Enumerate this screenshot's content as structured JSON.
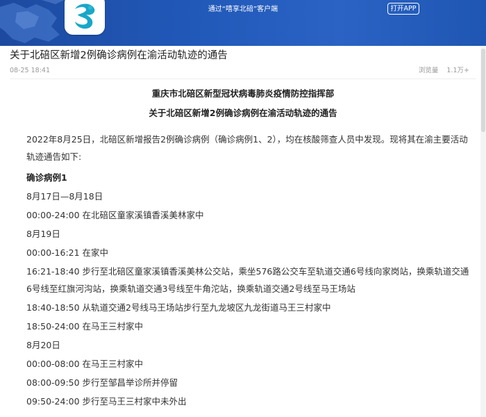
{
  "header": {
    "promo_text": "通过“嘻享北碚”客户端",
    "open_app_label": "打开APP",
    "logo_icon": "beibei-app-logo-icon",
    "brand_color": "#2159b9"
  },
  "article": {
    "title": "关于北碚区新增2例确诊病例在渝活动轨迹的通告",
    "time": "08-25 18:41",
    "views_label": "浏览量",
    "views_count": "1.1万+",
    "doc_heading_1": "重庆市北碚区新型冠状病毒肺炎疫情防控指挥部",
    "doc_heading_2": "关于北碚区新增2例确诊病例在渝活动轨迹的通告",
    "intro": "2022年8月25日，北碚区新增报告2例确诊病例（确诊病例1、2），均在核酸筛查人员中发现。现将其在渝主要活动轨迹通告如下:",
    "case1_label": "确诊病例1",
    "lines": [
      "8月17日—8月18日",
      "00:00-24:00 在北碚区童家溪镇香溪美林家中",
      "8月19日",
      "00:00-16:21 在家中",
      "16:21-18:40 步行至北碚区童家溪镇香溪美林公交站，乘坐576路公交车至轨道交通6号线向家岗站，换乘轨道交通6号线至红旗河沟站，换乘轨道交通3号线至牛角沱站，换乘轨道交通2号线至马王场站",
      "18:40-18:50 从轨道交通2号线马王场站步行至九龙坡区九龙街道马王三村家中",
      "18:50-24:00 在马王三村家中",
      "8月20日",
      "00:00-08:00 在马王三村家中",
      "08:00-09:50 步行至邹昌举诊所并停留",
      "09:50-24:00 步行至马王三村家中未外出"
    ]
  }
}
